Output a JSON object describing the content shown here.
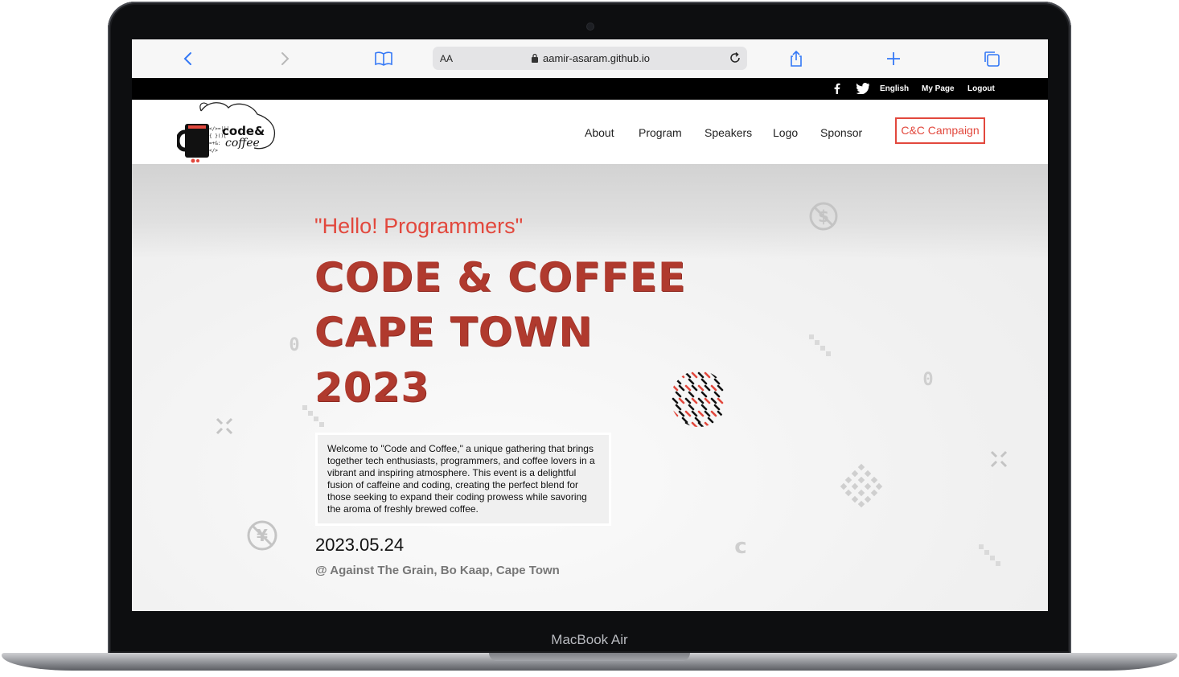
{
  "device": {
    "label": "MacBook Air"
  },
  "browser": {
    "aa_label": "AA",
    "url": "aamir-asaram.github.io"
  },
  "topbar": {
    "language": "English",
    "mypage": "My Page",
    "logout": "Logout"
  },
  "logo": {
    "text_line1": "code&",
    "text_line2": "coffee"
  },
  "nav": {
    "items": [
      "About",
      "Program",
      "Speakers",
      "Logo",
      "Sponsor"
    ],
    "campaign": "C&C Campaign"
  },
  "hero": {
    "greeting": "\"Hello! Programmers\"",
    "title_lines": [
      "CODE & COFFEE",
      "CAPE TOWN",
      "2023"
    ],
    "description": "Welcome to \"Code and Coffee,\" a unique gathering that brings together tech enthusiasts, programmers, and coffee lovers in a vibrant and inspiring atmosphere. This event is a delightful fusion of caffeine and coding, creating the perfect blend for those seeking to expand their coding prowess while savoring the aroma of freshly brewed coffee.",
    "date": "2023.05.24",
    "venue": "@ Against The Grain, Bo Kaap, Cape Town"
  },
  "colors": {
    "accent": "#e2483d",
    "title": "#b03a2e",
    "safari_blue": "#3478f6"
  }
}
